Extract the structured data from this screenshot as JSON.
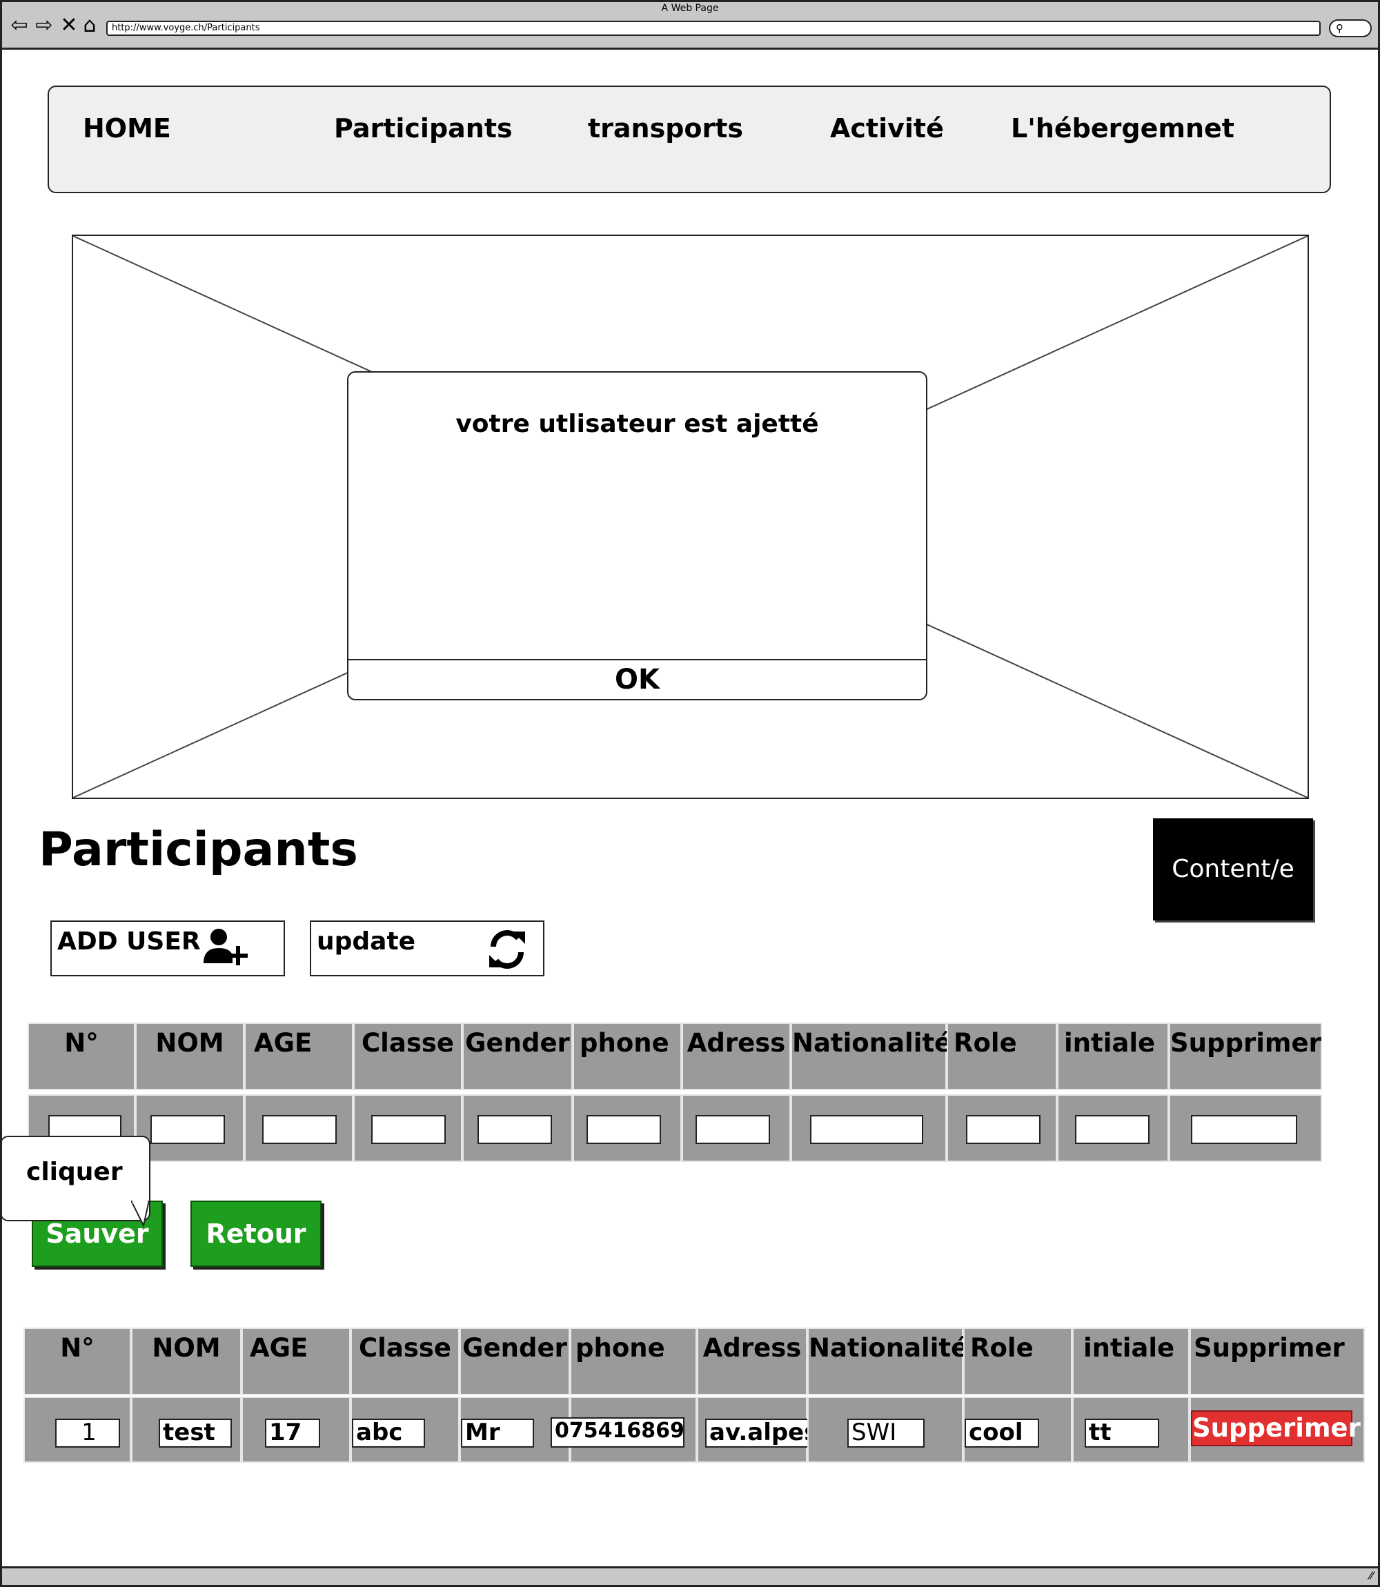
{
  "browser": {
    "window_title": "A Web Page",
    "url": "http://www.voyge.ch/Participants",
    "nav_icons": [
      "back-arrow-icon",
      "forward-arrow-icon",
      "stop-icon",
      "home-icon"
    ],
    "search_icon": "search-icon"
  },
  "nav": {
    "items": [
      {
        "label": "HOME"
      },
      {
        "label": "Participants"
      },
      {
        "label": "transports"
      },
      {
        "label": "Activité"
      },
      {
        "label": "L'hébergemnet"
      }
    ]
  },
  "dialog": {
    "message": "votre utlisateur est ajetté",
    "ok_label": "OK"
  },
  "page": {
    "title": "Participants",
    "content_button": "Content/e",
    "add_user_label": "ADD USER",
    "add_user_icon": "add-user-icon",
    "update_label": "update",
    "update_icon": "refresh-icon"
  },
  "form_table": {
    "headers": [
      "N°",
      "NOM",
      "AGE",
      "Classe",
      "Gender",
      "phone",
      "Adress",
      "Nationalité",
      "Role",
      "intiale",
      "Supprimer"
    ]
  },
  "tooltip": {
    "text": "cliquer"
  },
  "buttons": {
    "save": "Sauver",
    "back": "Retour"
  },
  "data_table": {
    "headers": [
      "N°",
      "NOM",
      "AGE",
      "Classe",
      "Gender",
      "phone",
      "Adress",
      "Nationalité",
      "Role",
      "intiale",
      "Supprimer"
    ],
    "row": [
      "1",
      "test",
      "17",
      "abc",
      "Mr",
      "075416869",
      "av.alpes",
      "SWI",
      "cool",
      "tt"
    ],
    "delete_label": "Supperimer"
  },
  "colors": {
    "green": "#1e9e1e",
    "red": "#e03030",
    "cell_gray": "#9a9a9a"
  }
}
